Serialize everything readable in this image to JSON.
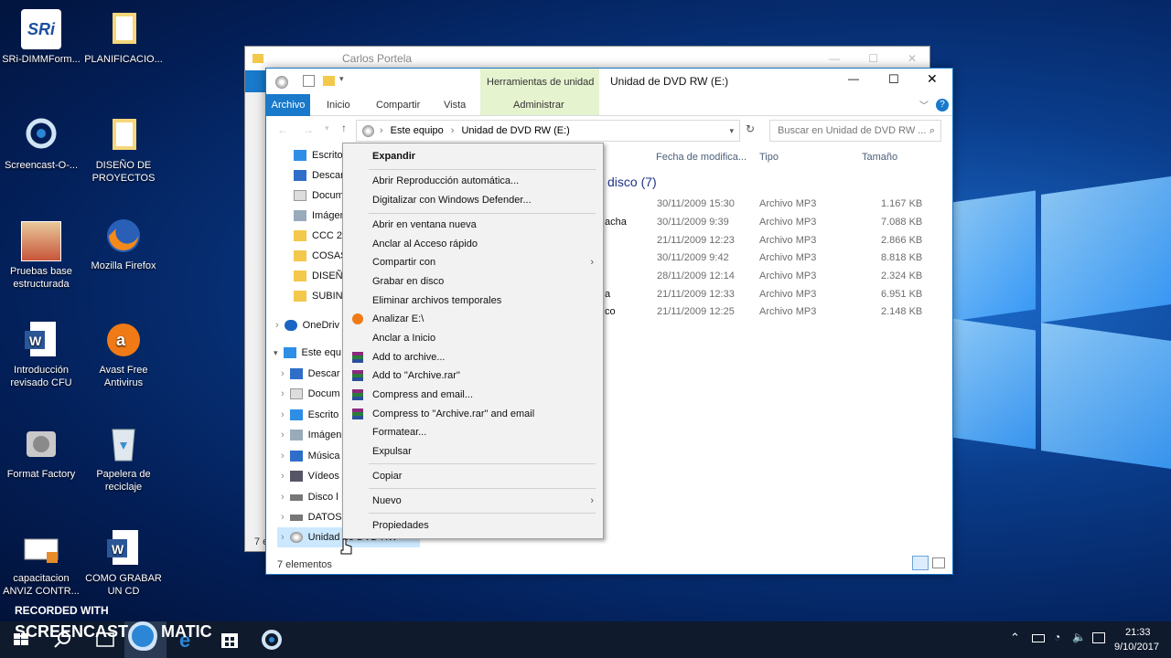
{
  "desktop": {
    "icons": [
      {
        "label": "SRi-DIMMForm..."
      },
      {
        "label": "PLANIFICACIO..."
      },
      {
        "label": "Screencast-O-..."
      },
      {
        "label": "DISEÑO DE PROYECTOS"
      },
      {
        "label": "Pruebas base estructurada"
      },
      {
        "label": "Mozilla Firefox"
      },
      {
        "label": "Introducción revisado CFU"
      },
      {
        "label": "Avast Free Antivirus"
      },
      {
        "label": "Format Factory"
      },
      {
        "label": "Papelera de reciclaje"
      },
      {
        "label": "capacitacion ANVIZ CONTR..."
      },
      {
        "label": "COMO GRABAR UN CD"
      }
    ],
    "sri_logo_text": "SRi"
  },
  "back_window": {
    "title": "Carlos Portela"
  },
  "window": {
    "title": "Unidad de DVD RW (E:)",
    "tools_tab": "Herramientas de unidad",
    "tabs": [
      "Archivo",
      "Inicio",
      "Compartir",
      "Vista",
      "Administrar"
    ],
    "address": {
      "parts": [
        "Este equipo",
        "Unidad de DVD RW (E:)"
      ]
    },
    "search_placeholder": "Buscar en Unidad de DVD RW ...",
    "columns": [
      "Fecha de modifica...",
      "Tipo",
      "Tamaño"
    ],
    "group_label": "l disco (7)",
    "files": [
      {
        "name_tail": "",
        "date": "30/11/2009 15:30",
        "type": "Archivo MP3",
        "size": "1.167 KB"
      },
      {
        "name_tail": "acha",
        "date": "30/11/2009 9:39",
        "type": "Archivo MP3",
        "size": "7.088 KB"
      },
      {
        "name_tail": "",
        "date": "21/11/2009 12:23",
        "type": "Archivo MP3",
        "size": "2.866 KB"
      },
      {
        "name_tail": "",
        "date": "30/11/2009 9:42",
        "type": "Archivo MP3",
        "size": "8.818 KB"
      },
      {
        "name_tail": "",
        "date": "28/11/2009 12:14",
        "type": "Archivo MP3",
        "size": "2.324 KB"
      },
      {
        "name_tail": "a",
        "date": "21/11/2009 12:33",
        "type": "Archivo MP3",
        "size": "6.951 KB"
      },
      {
        "name_tail": "co",
        "date": "21/11/2009 12:25",
        "type": "Archivo MP3",
        "size": "2.148 KB"
      }
    ],
    "nav": [
      "Escrito",
      "Descar",
      "Docum",
      "Imágen",
      "CCC 20",
      "COSAS",
      "DISEÑ",
      "SUBINS",
      "OneDriv",
      "Este equ",
      "Descar",
      "Docum",
      "Escrito",
      "Imágen",
      "Música",
      "Vídeos",
      "Disco l",
      "DATOS",
      "Unidad de DVD RW"
    ],
    "status": "7 elementos",
    "back_status": "7 e"
  },
  "context_menu": {
    "items": [
      {
        "label": "Expandir"
      },
      {
        "label": "Abrir Reproducción automática..."
      },
      {
        "label": "Digitalizar con Windows Defender..."
      },
      {
        "label": "Abrir en ventana nueva"
      },
      {
        "label": "Anclar al Acceso rápido"
      },
      {
        "label": "Compartir con"
      },
      {
        "label": "Grabar en disco"
      },
      {
        "label": "Eliminar archivos temporales"
      },
      {
        "label": "Analizar E:\\"
      },
      {
        "label": "Anclar a Inicio"
      },
      {
        "label": "Add to archive..."
      },
      {
        "label": "Add to \"Archive.rar\""
      },
      {
        "label": "Compress and email..."
      },
      {
        "label": "Compress to \"Archive.rar\" and email"
      },
      {
        "label": "Formatear..."
      },
      {
        "label": "Expulsar"
      },
      {
        "label": "Copiar"
      },
      {
        "label": "Nuevo"
      },
      {
        "label": "Propiedades"
      }
    ]
  },
  "watermark": {
    "line1": "RECORDED WITH",
    "line2a": "SCREENCAST",
    "line2b": "MATIC"
  },
  "taskbar": {
    "time": "21:33",
    "date": "9/10/2017"
  }
}
